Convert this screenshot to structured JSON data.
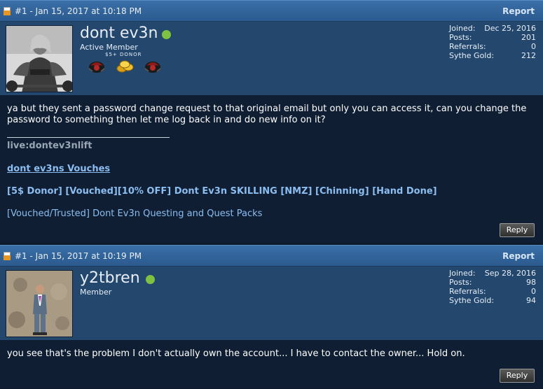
{
  "posts": [
    {
      "header": {
        "meta": "#1 - Jan 15, 2017 at 10:18 PM",
        "report_label": "Report"
      },
      "user": {
        "name": "dont ev3n",
        "title": "Active Member",
        "donor_label": "$5+ DONOR",
        "stats": {
          "joined_label": "Joined:",
          "joined": "Dec 25, 2016",
          "posts_label": "Posts:",
          "posts": "201",
          "referrals_label": "Referrals:",
          "referrals": "0",
          "gold_label": "Sythe Gold:",
          "gold": "212"
        }
      },
      "body": {
        "message": "ya but they sent a password change request to that original email but only you can access it, can you change the password to something then let me log back in and do new info on it?",
        "signature_name": "live:dontev3nlift",
        "signature_link": "dont ev3ns Vouches",
        "signature_services": "[5$ Donor] [Vouched][10% OFF] Dont Ev3n SKILLING [NMZ] [Chinning] [Hand Done]",
        "signature_questing": "[Vouched/Trusted] Dont Ev3n Questing and Quest Packs"
      },
      "reply_label": "Reply"
    },
    {
      "header": {
        "meta": "#1 - Jan 15, 2017 at 10:19 PM",
        "report_label": "Report"
      },
      "user": {
        "name": "y2tbren",
        "title": "Member",
        "stats": {
          "joined_label": "Joined:",
          "joined": "Sep 28, 2016",
          "posts_label": "Posts:",
          "posts": "98",
          "referrals_label": "Referrals:",
          "referrals": "0",
          "gold_label": "Sythe Gold:",
          "gold": "94"
        }
      },
      "body": {
        "message": "you see that's the problem I don't actually own the account... I have to contact the owner... Hold on."
      },
      "reply_label": "Reply"
    }
  ],
  "colors": {
    "header_bg": "#3a6fa8",
    "userinfo_bg": "#24476e",
    "body_bg": "#0f1e33",
    "online": "#7fc241",
    "link": "#8cbdf0"
  }
}
